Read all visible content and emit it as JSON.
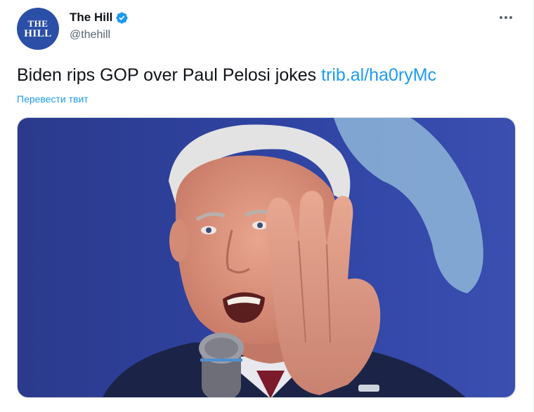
{
  "account": {
    "avatar_line1": "THE",
    "avatar_line2": "HILL",
    "display_name": "The Hill",
    "handle": "@thehill",
    "verified": true
  },
  "tweet": {
    "text": "Biden rips GOP over Paul Pelosi jokes ",
    "link": "trib.al/ha0ryMc",
    "translate_label": "Перевести твит"
  },
  "colors": {
    "link": "#1d9bf0",
    "text": "#0f1419",
    "secondary": "#536471",
    "brand": "#2b4fa6"
  },
  "icons": {
    "verified": "verified-badge-icon",
    "more": "more-options-icon"
  }
}
